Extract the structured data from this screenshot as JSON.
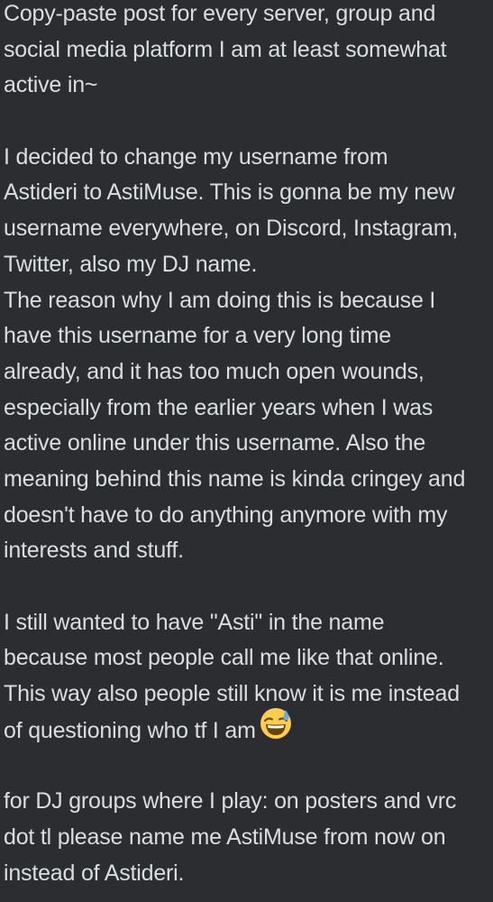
{
  "message": {
    "lines": [
      "Copy-paste post for every server, group and",
      "social media platform I am at least somewhat",
      "active in~",
      "",
      "I decided to change my username from",
      "Astideri to AstiMuse. This is gonna be my new",
      "username everywhere, on Discord, Instagram,",
      "Twitter, also my DJ name.",
      "The reason why I am doing this is because I",
      "have this username for a very long time",
      "already, and it has too much open wounds,",
      "especially from the earlier years when I was",
      "active online under this username. Also the",
      "meaning behind this name is kinda cringey and",
      "doesn't have to do anything anymore with my",
      "interests and stuff.",
      "",
      "I still wanted to have \"Asti\" in the name",
      "because most people call me like that online.",
      "This way also people still know it is me instead",
      "of questioning who tf I am",
      "",
      "for DJ groups where I play: on posters and vrc",
      "dot tl please name me AstiMuse from now on",
      "instead of Astideri."
    ],
    "emoji": "grinning-face-with-sweat-icon"
  }
}
